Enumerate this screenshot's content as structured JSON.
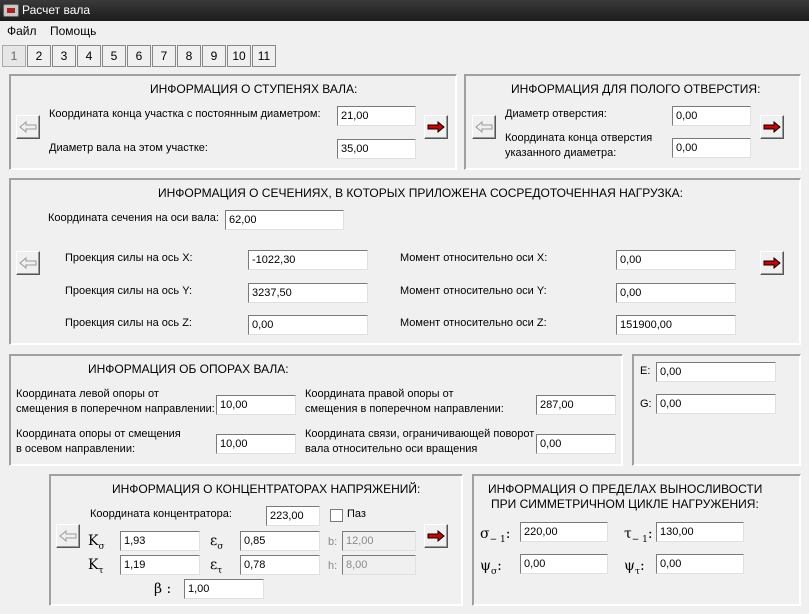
{
  "window": {
    "title": "Расчет вала"
  },
  "menu": {
    "file": "Файл",
    "help": "Помощь"
  },
  "tabs": [
    "1",
    "2",
    "3",
    "4",
    "5",
    "6",
    "7",
    "8",
    "9",
    "10",
    "11"
  ],
  "steps": {
    "title": "ИНФОРМАЦИЯ О СТУПЕНЯХ ВАЛА:",
    "coord_label": "Координата конца участка с постоянным диаметром:",
    "coord_value": "21,00",
    "diam_label": "Диаметр вала на этом участке:",
    "diam_value": "35,00"
  },
  "hollow": {
    "title": "ИНФОРМАЦИЯ ДЛЯ ПОЛОГО ОТВЕРСТИЯ:",
    "diam_label": "Диаметр отверстия:",
    "diam_value": "0,00",
    "coord_label_1": "Координата конца отверстия",
    "coord_label_2": "указанного диаметра:",
    "coord_value": "0,00"
  },
  "sections": {
    "title": "ИНФОРМАЦИЯ О СЕЧЕНИЯХ, В КОТОРЫХ ПРИЛОЖЕНА СОСРЕДОТОЧЕННАЯ НАГРУЗКА:",
    "coord_label": "Координата сечения на оси вала:",
    "coord_value": "62,00",
    "fx_label": "Проекция силы на ось X:",
    "fx_value": "-1022,30",
    "fy_label": "Проекция силы на ось Y:",
    "fy_value": "3237,50",
    "fz_label": "Проекция силы на ось Z:",
    "fz_value": "0,00",
    "mx_label": "Момент относительно оси X:",
    "mx_value": "0,00",
    "my_label": "Момент относительно оси Y:",
    "my_value": "0,00",
    "mz_label": "Момент относительно оси Z:",
    "mz_value": "151900,00"
  },
  "supports": {
    "title": "ИНФОРМАЦИЯ ОБ ОПОРАХ ВАЛА:",
    "left_label_1": "Координата левой опоры от",
    "left_label_2": "смещения в поперечном направлении:",
    "left_value": "10,00",
    "right_label_1": "Координата правой опоры от",
    "right_label_2": "смещения в поперечном направлении:",
    "right_value": "287,00",
    "axial_label_1": "Координата опоры от смещения",
    "axial_label_2": "в осевом направлении:",
    "axial_value": "10,00",
    "rot_label_1": "Координата связи, ограничивающей поворот",
    "rot_label_2": "вала относительно оси вращения",
    "rot_value": "0,00"
  },
  "moduli": {
    "e_label": "E:",
    "e_value": "0,00",
    "g_label": "G:",
    "g_value": "0,00"
  },
  "concentrators": {
    "title": "ИНФОРМАЦИЯ О КОНЦЕНТРАТОРАХ НАПРЯЖЕНИЙ:",
    "coord_label": "Координата концентратора:",
    "coord_value": "223,00",
    "groove_label": "Паз",
    "k_sigma_sym": "K",
    "k_sigma_sub": "σ",
    "k_sigma_value": "1,93",
    "k_tau_sym": "K",
    "k_tau_sub": "τ",
    "k_tau_value": "1,19",
    "e_sigma_sym": "ε",
    "e_sigma_sub": "σ",
    "e_sigma_value": "0,85",
    "e_tau_sym": "ε",
    "e_tau_sub": "τ",
    "e_tau_value": "0,78",
    "b_label": "b:",
    "b_value": "12,00",
    "h_label": "h:",
    "h_value": "8,00",
    "beta_sym": "β",
    "beta_colon": ":",
    "beta_value": "1,00"
  },
  "endurance": {
    "title_1": "ИНФОРМАЦИЯ О ПРЕДЕЛАХ ВЫНОСЛИВОСТИ",
    "title_2": "ПРИ СИММЕТРИЧНОМ ЦИКЛЕ НАГРУЖЕНИЯ:",
    "sigma_sym": "σ",
    "sigma_sub": "− 1",
    "sigma_value": "220,00",
    "tau_sym": "τ",
    "tau_sub": "− 1",
    "tau_value": "130,00",
    "psi_sigma_sym": "ψ",
    "psi_sigma_sub": "σ",
    "psi_sigma_value": "0,00",
    "psi_tau_sym": "ψ",
    "psi_tau_sub": "τ",
    "psi_tau_value": "0,00"
  },
  "colors": {
    "arrow_red": "#d40000",
    "titlebar": "#2a2a2a"
  }
}
